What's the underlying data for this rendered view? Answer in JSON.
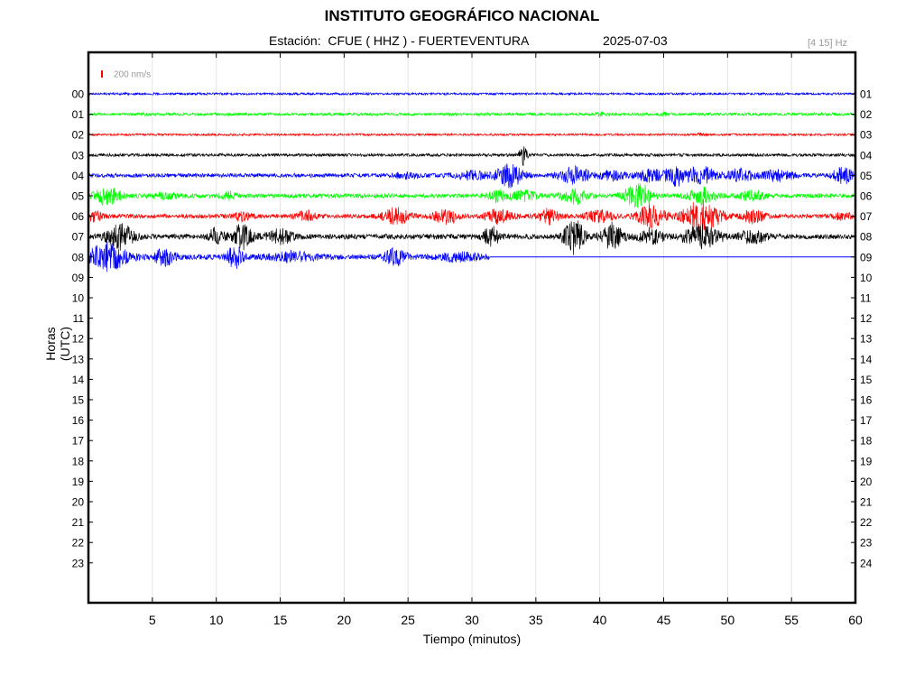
{
  "header": {
    "title": "INSTITUTO GEOGRÁFICO NACIONAL",
    "station_label": "Estación:  CFUE ( HHZ ) - FUERTEVENTURA",
    "date": "2025-07-03",
    "filter": "[4 15] Hz"
  },
  "chart_data": {
    "type": "line",
    "title": "INSTITUTO GEOGRÁFICO NACIONAL",
    "xlabel": "Tiempo (minutos)",
    "ylabel": "Horas (UTC)",
    "xlim": [
      0,
      60
    ],
    "x_ticks": [
      5,
      10,
      15,
      20,
      25,
      30,
      35,
      40,
      45,
      50,
      55,
      60
    ],
    "left_ticks": [
      "00",
      "01",
      "02",
      "03",
      "04",
      "05",
      "06",
      "07",
      "08",
      "09",
      "10",
      "11",
      "12",
      "13",
      "14",
      "15",
      "16",
      "17",
      "18",
      "19",
      "20",
      "21",
      "22",
      "23"
    ],
    "right_ticks": [
      "01",
      "02",
      "03",
      "04",
      "05",
      "06",
      "07",
      "08",
      "09",
      "10",
      "11",
      "12",
      "13",
      "14",
      "15",
      "16",
      "17",
      "18",
      "19",
      "20",
      "21",
      "22",
      "23",
      "24"
    ],
    "scale_label": "200 nm/s",
    "scale_color": "#ff0000",
    "grid": "vertical",
    "colors": [
      "#0000ff",
      "#00ff00",
      "#ff0000",
      "#000000"
    ],
    "series": [
      {
        "hour": 0,
        "color": "#0000ff",
        "end_min": 60,
        "base": 1.2,
        "events": []
      },
      {
        "hour": 1,
        "color": "#00ff00",
        "end_min": 60,
        "base": 1.6,
        "events": [
          [
            40,
            0.3,
            2
          ],
          [
            45,
            0.3,
            1.5
          ]
        ]
      },
      {
        "hour": 2,
        "color": "#ff0000",
        "end_min": 60,
        "base": 1.2,
        "events": [
          [
            48,
            0.3,
            1.5
          ]
        ]
      },
      {
        "hour": 3,
        "color": "#000000",
        "end_min": 60,
        "base": 1.6,
        "events": [
          [
            34,
            0.3,
            10
          ]
        ]
      },
      {
        "hour": 4,
        "color": "#0000ff",
        "end_min": 60,
        "base": 2.2,
        "events": [
          [
            25,
            1.0,
            3
          ],
          [
            30,
            1.5,
            4
          ],
          [
            33,
            1.0,
            12
          ],
          [
            38,
            1.2,
            9
          ],
          [
            41,
            1.0,
            5
          ],
          [
            44,
            1.2,
            6
          ],
          [
            46,
            0.8,
            10
          ],
          [
            48,
            1.2,
            9
          ],
          [
            51,
            1.0,
            7
          ],
          [
            54,
            1.2,
            6
          ],
          [
            59,
            0.8,
            9
          ]
        ]
      },
      {
        "hour": 5,
        "color": "#00ff00",
        "end_min": 60,
        "base": 2.4,
        "events": [
          [
            1.5,
            1.0,
            9
          ],
          [
            6,
            1.0,
            3
          ],
          [
            11,
            0.6,
            4
          ],
          [
            32,
            0.6,
            6
          ],
          [
            34,
            1.0,
            5
          ],
          [
            38,
            1.0,
            8
          ],
          [
            43,
            1.0,
            14
          ],
          [
            48,
            1.0,
            9
          ],
          [
            52,
            1.0,
            5
          ]
        ]
      },
      {
        "hour": 6,
        "color": "#ff0000",
        "end_min": 60,
        "base": 2.4,
        "events": [
          [
            0.5,
            0.6,
            5
          ],
          [
            12,
            0.6,
            4
          ],
          [
            17,
            0.8,
            5
          ],
          [
            24,
            1.0,
            9
          ],
          [
            28,
            1.0,
            7
          ],
          [
            32,
            1.0,
            8
          ],
          [
            36,
            0.8,
            8
          ],
          [
            40,
            1.0,
            6
          ],
          [
            44,
            1.0,
            12
          ],
          [
            48,
            1.4,
            17
          ],
          [
            52,
            0.8,
            7
          ],
          [
            59,
            0.6,
            5
          ]
        ]
      },
      {
        "hour": 7,
        "color": "#000000",
        "end_min": 60,
        "base": 2.8,
        "events": [
          [
            2.5,
            1.0,
            13
          ],
          [
            10,
            0.6,
            9
          ],
          [
            12,
            0.8,
            13
          ],
          [
            15,
            1.0,
            7
          ],
          [
            31.5,
            0.6,
            10
          ],
          [
            38,
            0.8,
            18
          ],
          [
            41,
            0.8,
            14
          ],
          [
            44,
            1.0,
            8
          ],
          [
            48,
            1.4,
            12
          ],
          [
            52,
            1.0,
            7
          ]
        ]
      },
      {
        "hour": 8,
        "color": "#0000ff",
        "end_min": 31.4,
        "base": 3.0,
        "events": [
          [
            1.5,
            1.5,
            14
          ],
          [
            6,
            0.8,
            8
          ],
          [
            11.5,
            0.6,
            12
          ],
          [
            16,
            1.5,
            5
          ],
          [
            24,
            0.8,
            8
          ],
          [
            29,
            1.5,
            4
          ]
        ]
      }
    ]
  }
}
